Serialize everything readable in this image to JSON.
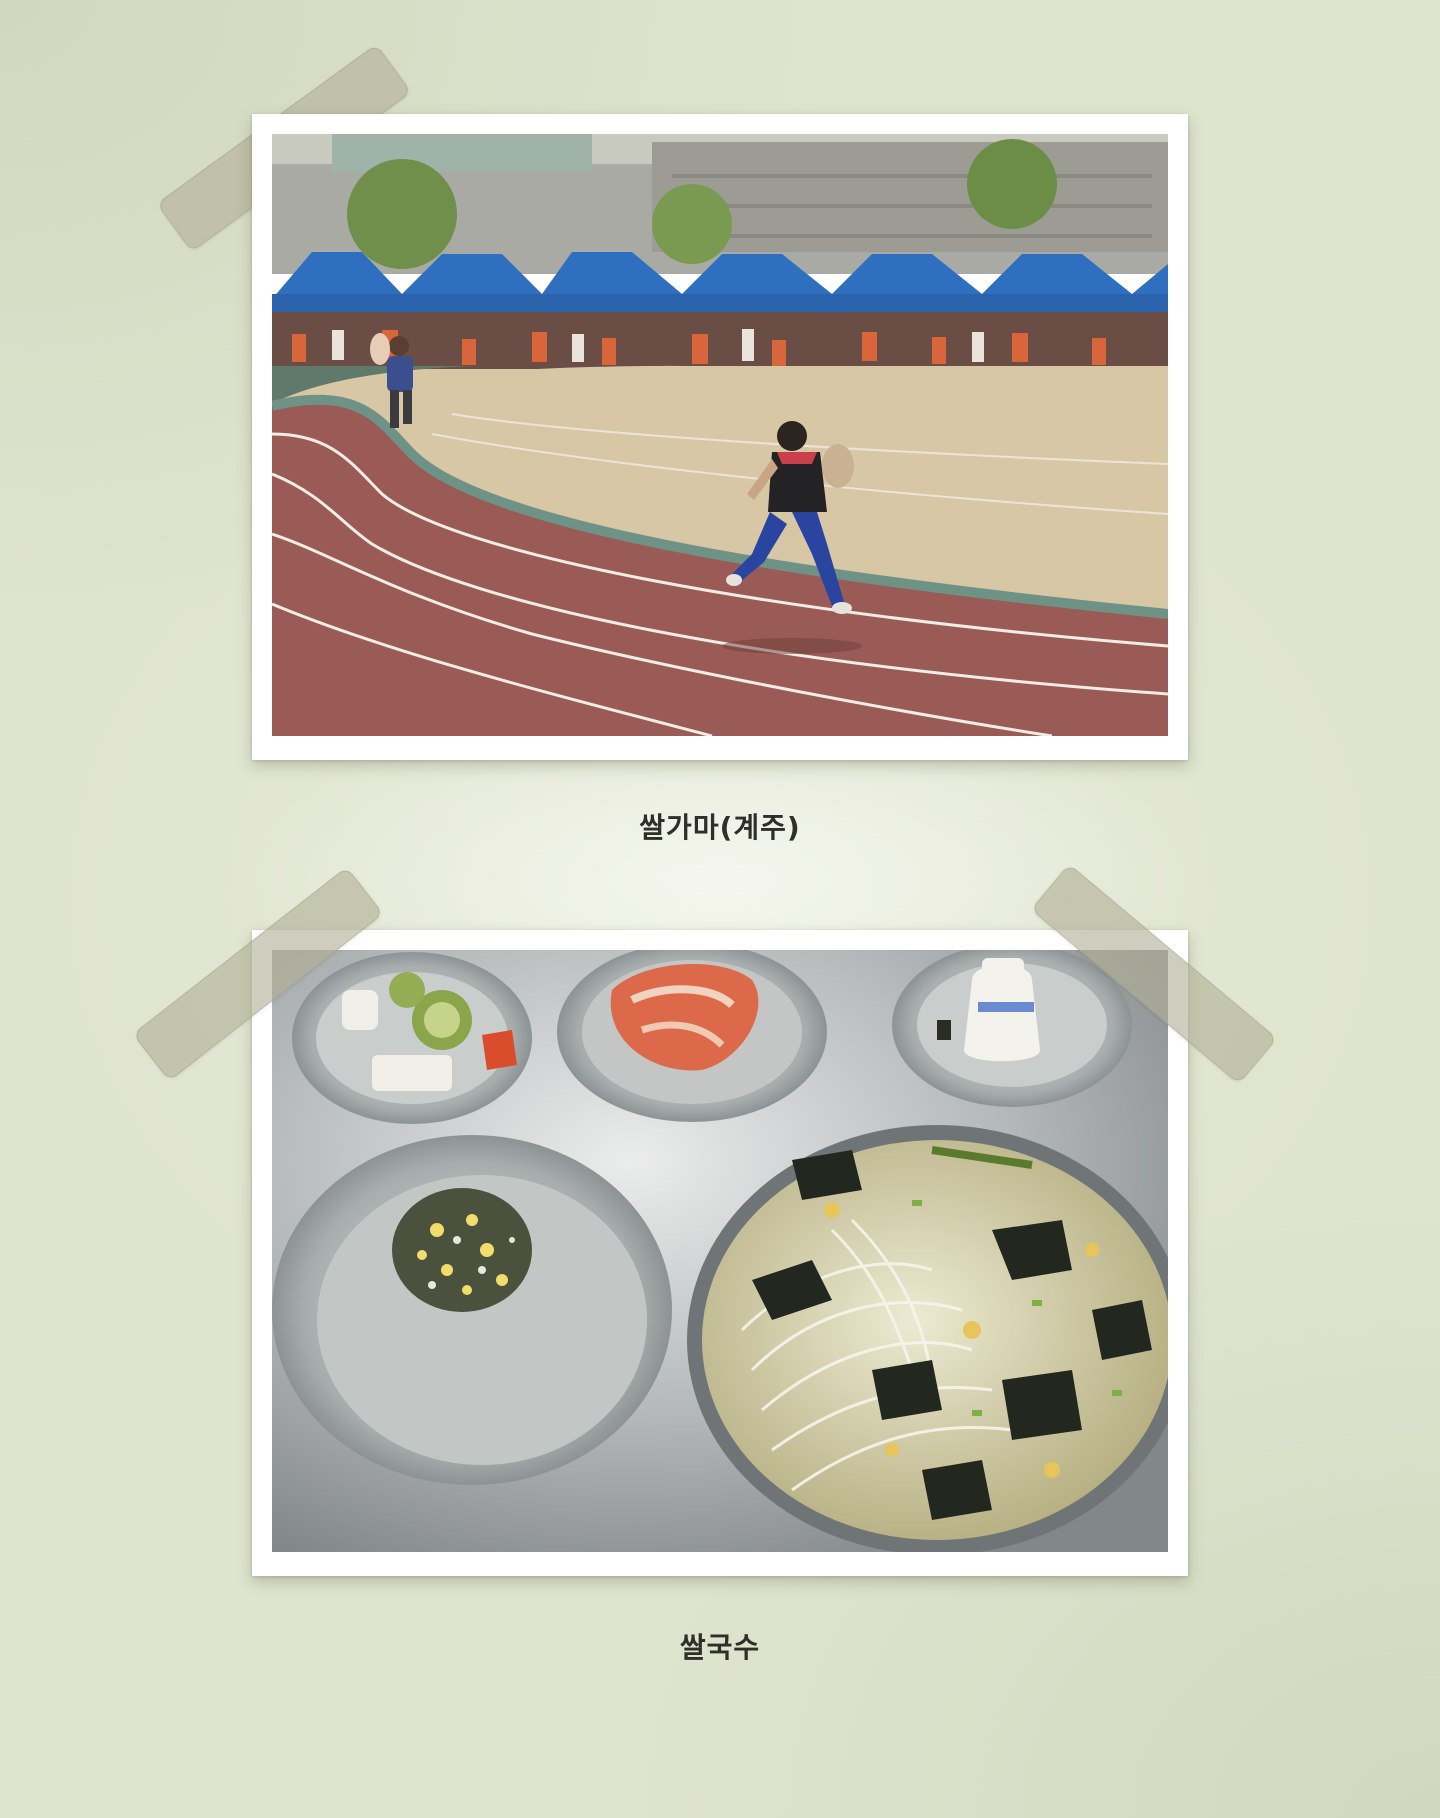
{
  "photos": [
    {
      "caption": "쌀가마(계주)",
      "scene": "relay-race"
    },
    {
      "caption": "쌀국수",
      "scene": "school-lunch-tray"
    }
  ],
  "colors": {
    "background": "#dfe4cf",
    "frame": "#ffffff",
    "tape": "#b2b096",
    "caption_text": "#2e2e2a",
    "track": "#9a5a55",
    "tent": "#2f6fc0",
    "field": "#d8c7a5"
  }
}
